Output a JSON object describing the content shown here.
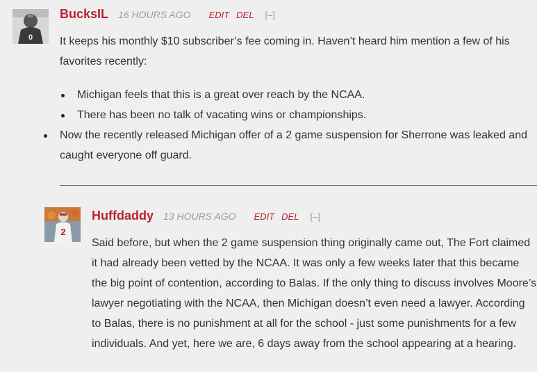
{
  "comments": [
    {
      "author": "BucksIL",
      "time": "16 HOURS AGO",
      "edit_label": "EDIT",
      "del_label": "DEL",
      "collapse_label": "[–]",
      "paragraph": "It keeps his monthly $10 subscriber’s fee coming in. Haven’t heard him mention a few of his favorites recently:",
      "bullets": [
        "Michigan feels that this is a great over reach by the NCAA.",
        "There has been no talk of vacating wins or championships.",
        "Now the recently released Michigan offer of a 2 game suspension for Sherrone was leaked and caught everyone off guard."
      ]
    },
    {
      "author": "Huffdaddy",
      "time": "13 HOURS AGO",
      "edit_label": "EDIT",
      "del_label": "DEL",
      "collapse_label": "[–]",
      "paragraph": "Said before, but when the 2 game suspension thing originally came out, The Fort claimed it had already been vetted by the NCAA. It was only a few weeks later that this became the big point of contention, according to Balas. If the only thing to discuss involves Moore’s lawyer negotiating with the NCAA, then Michigan doesn’t even need a lawyer. According to Balas, there is no punishment at all for the school - just some punishments for a few individuals. And yet, here we are, 6 days away from the school appearing at a hearing."
    }
  ],
  "colors": {
    "accent": "#b7222f",
    "muted": "#9a9a9a",
    "background": "#efefef"
  }
}
